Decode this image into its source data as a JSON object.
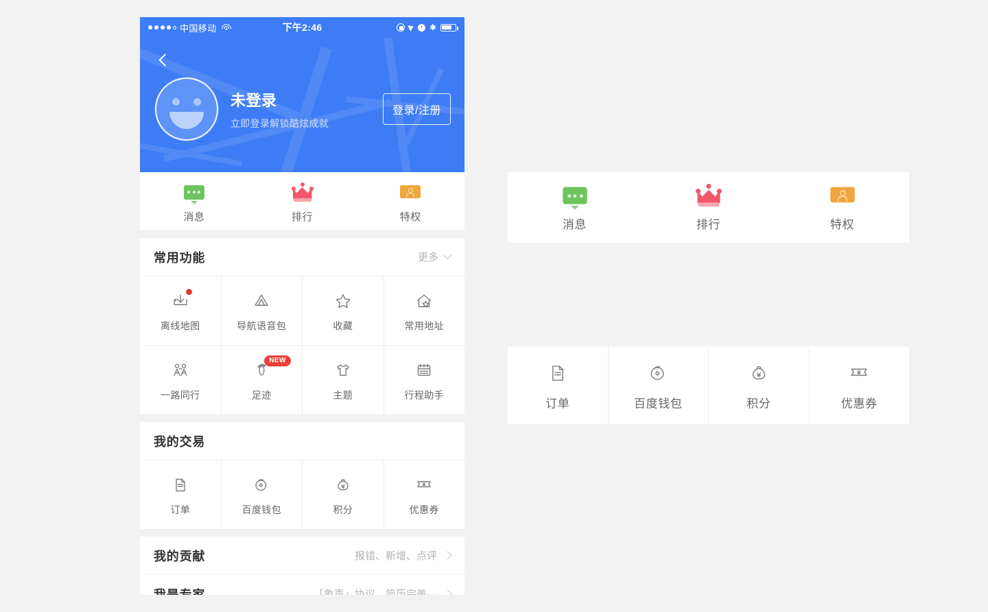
{
  "statusbar": {
    "carrier": "中国移动",
    "time": "下午2:46",
    "signal_icon": "signal-dots-icon",
    "wifi_icon": "wifi-icon",
    "lock_icon": "rotation-lock-icon",
    "location_icon": "location-arrow-icon",
    "alarm_icon": "alarm-clock-icon",
    "bluetooth_icon": "bluetooth-icon",
    "bluetooth_glyph": "✱",
    "battery_icon": "battery-icon"
  },
  "header": {
    "back_icon": "back-chevron-icon",
    "avatar_icon": "smiley-avatar-icon",
    "name": "未登录",
    "subtitle": "立即登录解锁酷炫成就",
    "login_button": "登录/注册",
    "bg_color": "#3e7cf6"
  },
  "quick_row": {
    "items": [
      {
        "label": "消息",
        "icon": "message-bubble-icon",
        "color": "#6ec45e"
      },
      {
        "label": "排行",
        "icon": "crown-icon",
        "color": "#f4566a"
      },
      {
        "label": "特权",
        "icon": "privilege-card-icon",
        "color": "#f0a63c"
      }
    ]
  },
  "common_functions": {
    "title": "常用功能",
    "more_label": "更多",
    "more_icon": "chevron-down-icon",
    "row1": [
      {
        "label": "离线地图",
        "icon": "offline-map-download-icon",
        "badge": "dot"
      },
      {
        "label": "导航语音包",
        "icon": "navigation-voice-icon",
        "badge": ""
      },
      {
        "label": "收藏",
        "icon": "star-favorite-icon",
        "badge": ""
      },
      {
        "label": "常用地址",
        "icon": "home-star-address-icon",
        "badge": ""
      }
    ],
    "row2": [
      {
        "label": "一路同行",
        "icon": "companions-icon",
        "badge": ""
      },
      {
        "label": "足迹",
        "icon": "footprint-icon",
        "badge": "NEW"
      },
      {
        "label": "主题",
        "icon": "tshirt-theme-icon",
        "badge": ""
      },
      {
        "label": "行程助手",
        "icon": "calendar-trip-icon",
        "badge": ""
      }
    ]
  },
  "my_trades": {
    "title": "我的交易",
    "items": [
      {
        "label": "订单",
        "icon": "document-order-icon"
      },
      {
        "label": "百度钱包",
        "icon": "wallet-coin-icon"
      },
      {
        "label": "积分",
        "icon": "money-bag-points-icon"
      },
      {
        "label": "优惠券",
        "icon": "coupon-ticket-icon"
      }
    ]
  },
  "my_contribution": {
    "title": "我的贡献",
    "hint": "报错、新增、点评",
    "arrow_icon": "chevron-right-icon"
  },
  "my_expert": {
    "title": "我是专家",
    "hint": "「象声」协议、简历完善···",
    "arrow_icon": "chevron-right-icon"
  },
  "callout_quick_row": {
    "items": [
      {
        "label": "消息",
        "icon": "message-bubble-icon",
        "color": "#6ec45e"
      },
      {
        "label": "排行",
        "icon": "crown-icon",
        "color": "#f4566a"
      },
      {
        "label": "特权",
        "icon": "privilege-card-icon",
        "color": "#f0a63c"
      }
    ]
  },
  "callout_trades_row": {
    "items": [
      {
        "label": "订单",
        "icon": "document-order-icon"
      },
      {
        "label": "百度钱包",
        "icon": "wallet-coin-icon"
      },
      {
        "label": "积分",
        "icon": "money-bag-points-icon"
      },
      {
        "label": "优惠券",
        "icon": "coupon-ticket-icon"
      }
    ]
  },
  "page": {
    "background": "#f2f2f2"
  }
}
